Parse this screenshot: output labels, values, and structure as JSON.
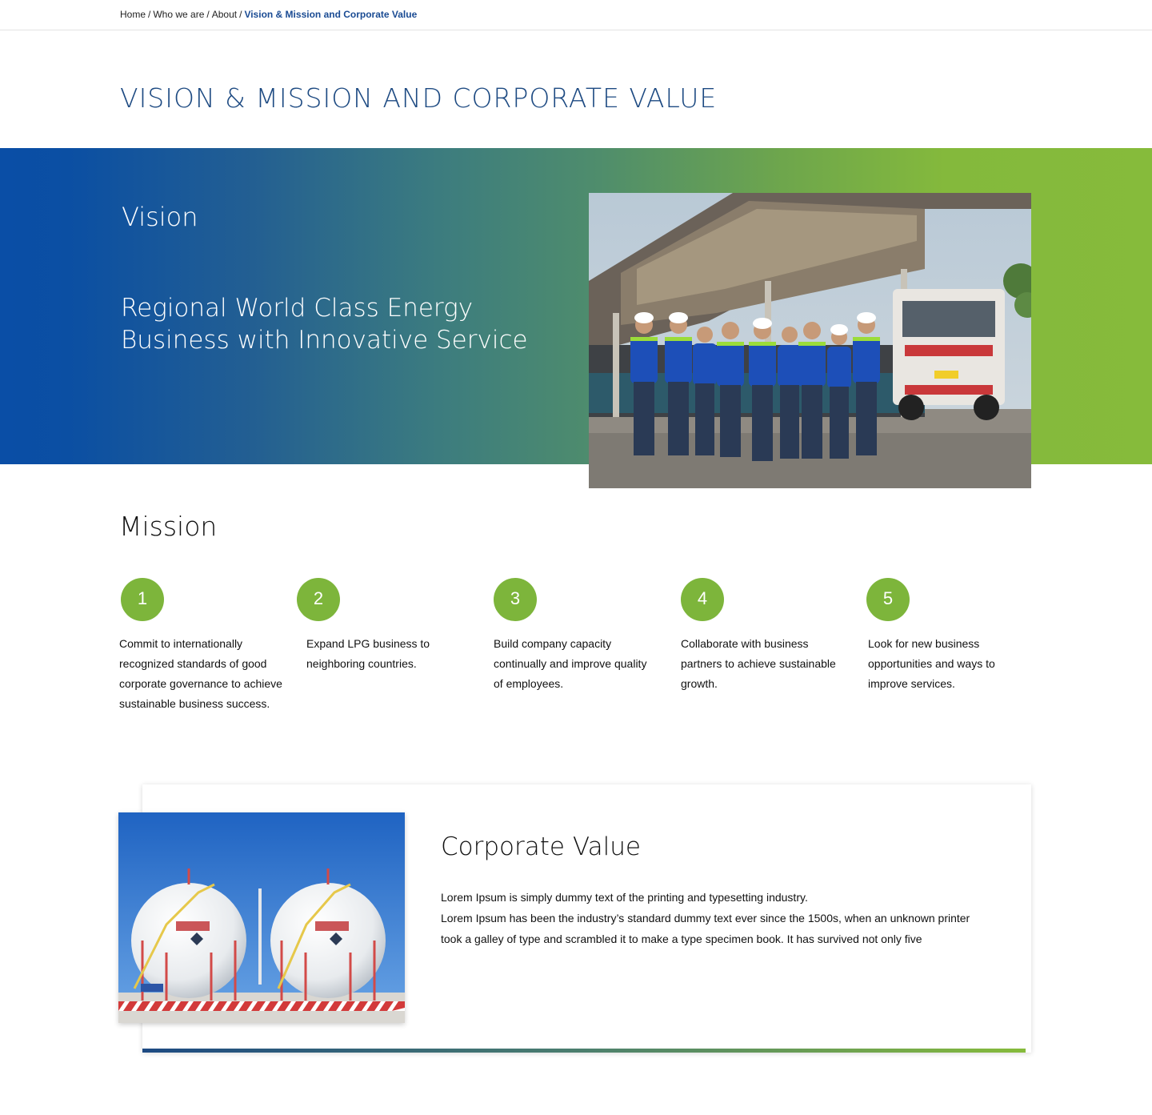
{
  "breadcrumb": {
    "items": [
      "Home",
      "Who we are",
      "About"
    ],
    "separator": "/",
    "current": "Vision & Mission and Corporate Value"
  },
  "page": {
    "title": "VISION & MISSION AND CORPORATE VALUE"
  },
  "vision": {
    "heading": "Vision",
    "statement_line1": "Regional World Class Energy",
    "statement_line2": "Business with Innovative Service",
    "photo_icon": "team-photo"
  },
  "mission": {
    "heading": "Mission",
    "items": [
      {
        "number": "1",
        "text": "Commit to internationally recognized standards of good corporate governance to achieve sustainable business success."
      },
      {
        "number": "2",
        "text": "Expand LPG business to neighboring countries."
      },
      {
        "number": "3",
        "text": "Build company capacity continually and improve quality of employees."
      },
      {
        "number": "4",
        "text": "Collaborate with business partners to achieve sustainable growth."
      },
      {
        "number": "5",
        "text": "Look for new business opportunities and ways to improve services."
      }
    ]
  },
  "corporate_value": {
    "heading": "Corporate Value",
    "paragraph1": "Lorem Ipsum is simply dummy text of the printing and typesetting industry.",
    "paragraph2": "Lorem Ipsum has been the industry’s standard dummy text ever since the 1500s, when an unknown printer took a galley of type and scrambled it to make a type specimen book. It has survived not only five",
    "photo_icon": "lpg-tank-photo"
  },
  "colors": {
    "brand_blue": "#1d4a82",
    "gradient_start": "#0a4ea6",
    "gradient_end": "#86bb3b",
    "mission_badge": "#7db53b"
  }
}
